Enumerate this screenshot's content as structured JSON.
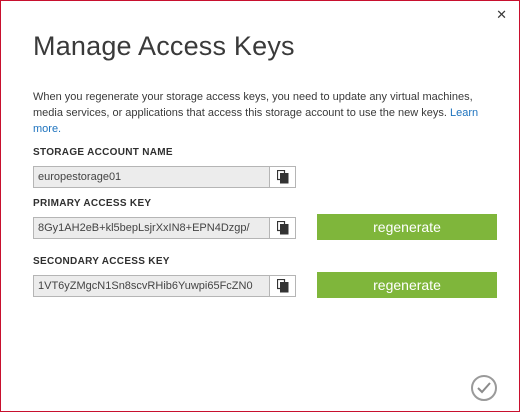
{
  "dialog": {
    "title": "Manage Access Keys",
    "description": "When you regenerate your storage access keys, you need to update any virtual machines, media services, or applications that access this storage account to use the new keys.",
    "learn_more": "Learn more.",
    "close_icon": "close-icon",
    "ok_icon": "checkmark-icon"
  },
  "account": {
    "label": "STORAGE ACCOUNT NAME",
    "value": "europestorage01"
  },
  "primary": {
    "label": "PRIMARY ACCESS KEY",
    "value": "8Gy1AH2eB+kl5bepLsjrXxIN8+EPN4Dzgp/",
    "regenerate_label": "regenerate"
  },
  "secondary": {
    "label": "SECONDARY ACCESS KEY",
    "value": "1VT6yZMgcN1Sn8scvRHib6Yuwpi65FcZN0",
    "regenerate_label": "regenerate"
  },
  "colors": {
    "accent_green": "#7fb63b",
    "link_blue": "#1e73be",
    "frame_red": "#c8102e"
  }
}
